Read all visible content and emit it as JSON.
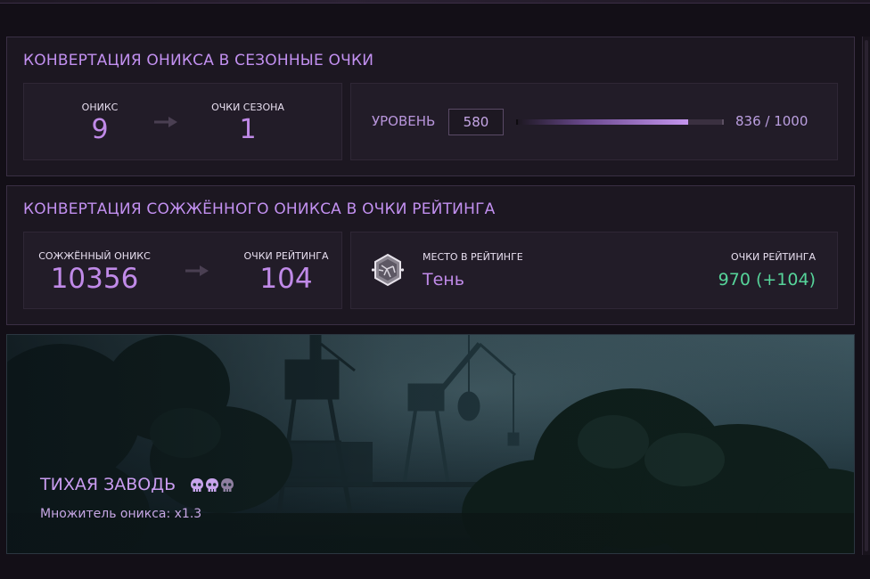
{
  "onyx_conversion": {
    "title": "КОНВЕРТАЦИЯ ОНИКСА В СЕЗОННЫЕ ОЧКИ",
    "onyx_label": "ОНИКС",
    "onyx_value": "9",
    "season_points_label": "ОЧКИ СЕЗОНА",
    "season_points_value": "1",
    "level_label": "УРОВЕНЬ",
    "level_value": "580",
    "progress_text": "836 / 1000",
    "progress_fraction": 0.836
  },
  "burned_conversion": {
    "title": "КОНВЕРТАЦИЯ СОЖЖЁННОГО ОНИКСА В ОЧКИ РЕЙТИНГА",
    "burned_label": "СОЖЖЁННЫЙ ОНИКС",
    "burned_value": "10356",
    "rating_points_label": "ОЧКИ РЕЙТИНГА",
    "rating_points_value": "104",
    "rank_place_label": "МЕСТО В РЕЙТИНГЕ",
    "rank_name": "Тень",
    "rank_icon": "cracked-stone-emblem-icon",
    "total_rating_label": "ОЧКИ РЕЙТИНГА",
    "total_rating_value": "970 (+104)"
  },
  "map": {
    "name": "ТИХАЯ ЗАВОДЬ",
    "difficulty_icon": "skull-icon",
    "difficulty_level": 2,
    "difficulty_max": 3,
    "multiplier_text": "Множитель оникса:  x1.3"
  },
  "colors": {
    "accent": "#c290f0",
    "positive": "#56d49a",
    "panel_bg": "#1c1721"
  }
}
